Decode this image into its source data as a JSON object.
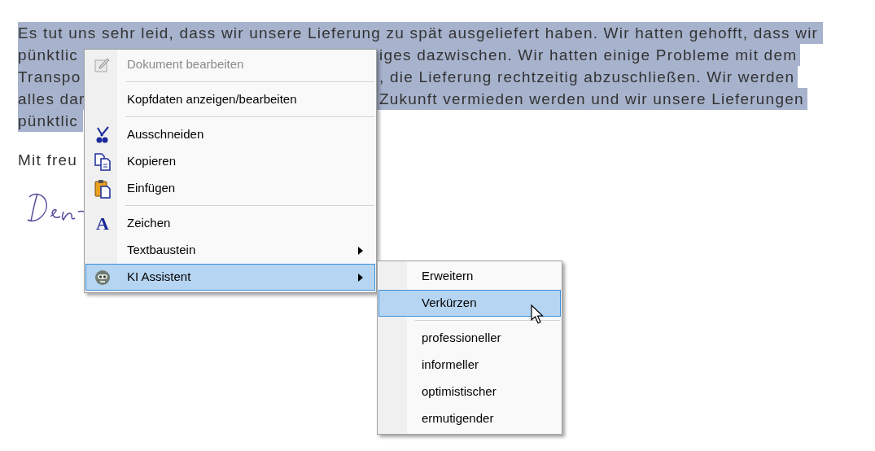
{
  "document": {
    "lines": [
      {
        "left": "Es tut uns sehr leid, dass wir unsere Lieferung zu spät ausgeliefert haben. Wir hatten gehofft, dass wir"
      },
      {
        "left": "pünktlic",
        "right": "iges dazwischen. Wir hatten einige Probleme mit dem"
      },
      {
        "left": "Transpo",
        "right": ", die Lieferung rechtzeitig abzuschließen. Wir werden"
      },
      {
        "left": "alles dar",
        "right": "Zukunft vermieden werden und wir unsere Lieferungen"
      },
      {
        "left": "pünktlic"
      }
    ],
    "closing": "Mit freu"
  },
  "context_menu": {
    "items": [
      {
        "kind": "item",
        "label": "Dokument bearbeiten",
        "disabled": true,
        "selected": false,
        "submenu": false
      },
      {
        "kind": "separator"
      },
      {
        "kind": "item",
        "label": "Kopfdaten anzeigen/bearbeiten",
        "disabled": false,
        "selected": false,
        "submenu": false
      },
      {
        "kind": "separator"
      },
      {
        "kind": "item",
        "label": "Ausschneiden",
        "disabled": false,
        "selected": false,
        "submenu": false
      },
      {
        "kind": "item",
        "label": "Kopieren",
        "disabled": false,
        "selected": false,
        "submenu": false
      },
      {
        "kind": "item",
        "label": "Einfügen",
        "disabled": false,
        "selected": false,
        "submenu": false
      },
      {
        "kind": "separator"
      },
      {
        "kind": "item",
        "label": "Zeichen",
        "glyph": "A",
        "disabled": false,
        "selected": false,
        "submenu": false
      },
      {
        "kind": "item",
        "label": "Textbaustein",
        "disabled": false,
        "selected": false,
        "submenu": true
      },
      {
        "kind": "item",
        "label": "KI Assistent",
        "disabled": false,
        "selected": true,
        "submenu": true
      }
    ]
  },
  "submenu": {
    "items": [
      {
        "kind": "item",
        "label": "Erweitern",
        "selected": false
      },
      {
        "kind": "item",
        "label": "Verkürzen",
        "selected": true
      },
      {
        "kind": "separator"
      },
      {
        "kind": "item",
        "label": "professioneller",
        "selected": false
      },
      {
        "kind": "item",
        "label": "informeller",
        "selected": false
      },
      {
        "kind": "item",
        "label": "optimistischer",
        "selected": false
      },
      {
        "kind": "item",
        "label": "ermutigender",
        "selected": false
      }
    ]
  }
}
